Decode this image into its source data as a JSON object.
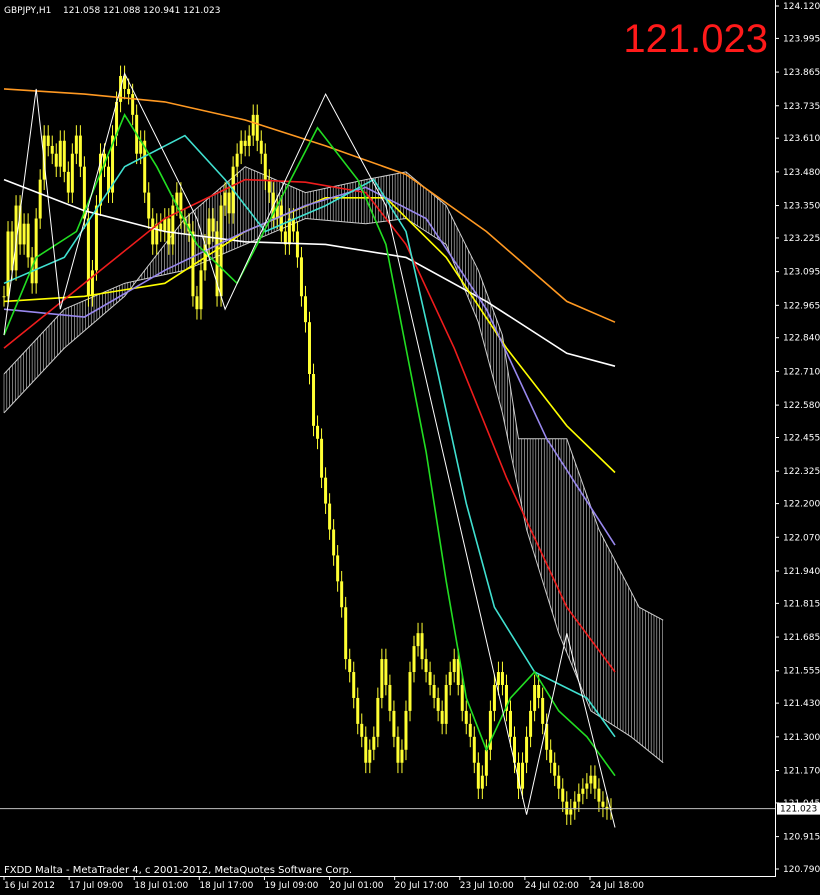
{
  "header": {
    "symbol": "GBPJPY,H1",
    "ohlc": "121.058 121.088 120.941 121.023"
  },
  "big_price": "121.023",
  "copyright": "FXDD Malta - MetaTrader 4, c 2001-2012, MetaQuotes Software Corp.",
  "colors": {
    "background": "#000000",
    "candles": "#ffff33",
    "sma_green": "#22dd22",
    "sma_cyan": "#40e0d0",
    "sma_red": "#ee1c1c",
    "sma_purple": "#9988ee",
    "sma_yellow": "#ffff00",
    "sma_white": "#ffffff",
    "sma_orange": "#ff9922",
    "cloud": "#cccccc",
    "zigzag": "#ffffff",
    "current_price_line": "#c0c0c0",
    "big_price": "#ff1a1a"
  },
  "chart_data": {
    "type": "line",
    "title": "GBPJPY,H1",
    "ylim": [
      120.79,
      124.12
    ],
    "y_ticks": [
      "124.120",
      "123.995",
      "123.865",
      "123.735",
      "123.610",
      "123.480",
      "123.350",
      "123.225",
      "123.095",
      "122.965",
      "122.840",
      "122.710",
      "122.580",
      "122.455",
      "122.325",
      "122.200",
      "122.070",
      "121.940",
      "121.815",
      "121.685",
      "121.555",
      "121.430",
      "121.300",
      "121.170",
      "121.045",
      "120.915",
      "120.790"
    ],
    "x_ticks": [
      "16 Jul 2012",
      "17 Jul 09:00",
      "18 Jul 01:00",
      "18 Jul 17:00",
      "19 Jul 09:00",
      "20 Jul 01:00",
      "20 Jul 17:00",
      "23 Jul 10:00",
      "24 Jul 02:00",
      "24 Jul 18:00"
    ],
    "current_price": 121.023,
    "bars": 152,
    "candles_close": [
      123.0,
      123.25,
      123.1,
      123.35,
      123.2,
      123.28,
      123.15,
      123.05,
      123.3,
      123.45,
      123.62,
      123.58,
      123.55,
      123.5,
      123.6,
      123.48,
      123.4,
      123.55,
      123.62,
      123.5,
      123.3,
      123.0,
      123.1,
      123.35,
      123.55,
      123.5,
      123.4,
      123.62,
      123.75,
      123.85,
      123.8,
      123.78,
      123.7,
      123.55,
      123.6,
      123.4,
      123.3,
      123.2,
      123.28,
      123.25,
      123.3,
      123.2,
      123.35,
      123.4,
      123.3,
      123.28,
      123.25,
      123.0,
      122.95,
      123.1,
      123.2,
      123.3,
      123.25,
      123.0,
      123.35,
      123.4,
      123.32,
      123.5,
      123.55,
      123.6,
      123.58,
      123.62,
      123.7,
      123.6,
      123.55,
      123.45,
      123.4,
      123.3,
      123.35,
      123.25,
      123.2,
      123.3,
      123.25,
      123.15,
      123.0,
      122.9,
      122.7,
      122.5,
      122.45,
      122.3,
      122.2,
      122.1,
      122.0,
      121.9,
      121.8,
      121.6,
      121.55,
      121.45,
      121.35,
      121.3,
      121.2,
      121.25,
      121.3,
      121.45,
      121.6,
      121.5,
      121.4,
      121.3,
      121.2,
      121.25,
      121.4,
      121.55,
      121.65,
      121.7,
      121.6,
      121.55,
      121.5,
      121.45,
      121.4,
      121.35,
      121.5,
      121.55,
      121.6,
      121.5,
      121.4,
      121.35,
      121.3,
      121.2,
      121.1,
      121.15,
      121.25,
      121.4,
      121.5,
      121.55,
      121.5,
      121.4,
      121.3,
      121.2,
      121.1,
      121.2,
      121.3,
      121.4,
      121.5,
      121.45,
      121.35,
      121.25,
      121.2,
      121.15,
      121.1,
      121.05,
      121.0,
      121.02,
      121.05,
      121.08,
      121.1,
      121.12,
      121.15,
      121.1,
      121.05,
      121.03,
      121.02,
      121.023
    ],
    "series": [
      {
        "name": "",
        "color_key": "sma_orange",
        "points": [
          [
            0,
            123.8
          ],
          [
            20,
            123.78
          ],
          [
            40,
            123.75
          ],
          [
            60,
            123.68
          ],
          [
            80,
            123.58
          ],
          [
            100,
            123.47
          ],
          [
            120,
            123.25
          ],
          [
            140,
            122.98
          ],
          [
            152,
            122.9
          ]
        ]
      },
      {
        "name": "",
        "color_key": "sma_white",
        "points": [
          [
            0,
            123.45
          ],
          [
            20,
            123.33
          ],
          [
            40,
            123.25
          ],
          [
            60,
            123.21
          ],
          [
            80,
            123.2
          ],
          [
            100,
            123.15
          ],
          [
            120,
            122.98
          ],
          [
            140,
            122.78
          ],
          [
            152,
            122.73
          ]
        ]
      },
      {
        "name": "",
        "color_key": "sma_yellow",
        "points": [
          [
            0,
            122.98
          ],
          [
            20,
            123.0
          ],
          [
            40,
            123.05
          ],
          [
            60,
            123.25
          ],
          [
            80,
            123.38
          ],
          [
            95,
            123.38
          ],
          [
            110,
            123.15
          ],
          [
            125,
            122.8
          ],
          [
            140,
            122.5
          ],
          [
            152,
            122.32
          ]
        ]
      },
      {
        "name": "",
        "color_key": "sma_purple",
        "points": [
          [
            0,
            122.95
          ],
          [
            20,
            122.92
          ],
          [
            40,
            123.1
          ],
          [
            60,
            123.25
          ],
          [
            75,
            123.35
          ],
          [
            90,
            123.42
          ],
          [
            105,
            123.3
          ],
          [
            120,
            122.95
          ],
          [
            135,
            122.45
          ],
          [
            152,
            122.04
          ]
        ]
      },
      {
        "name": "",
        "color_key": "sma_red",
        "points": [
          [
            0,
            122.8
          ],
          [
            20,
            123.05
          ],
          [
            40,
            123.3
          ],
          [
            60,
            123.45
          ],
          [
            75,
            123.44
          ],
          [
            90,
            123.4
          ],
          [
            100,
            123.2
          ],
          [
            112,
            122.8
          ],
          [
            125,
            122.3
          ],
          [
            140,
            121.8
          ],
          [
            152,
            121.55
          ]
        ]
      },
      {
        "name": "",
        "color_key": "sma_cyan",
        "points": [
          [
            0,
            123.05
          ],
          [
            15,
            123.15
          ],
          [
            30,
            123.5
          ],
          [
            45,
            123.62
          ],
          [
            55,
            123.45
          ],
          [
            65,
            123.25
          ],
          [
            80,
            123.35
          ],
          [
            92,
            123.45
          ],
          [
            100,
            123.25
          ],
          [
            108,
            122.7
          ],
          [
            115,
            122.2
          ],
          [
            122,
            121.8
          ],
          [
            132,
            121.55
          ],
          [
            145,
            121.45
          ],
          [
            152,
            121.3
          ]
        ]
      },
      {
        "name": "",
        "color_key": "sma_green",
        "points": [
          [
            0,
            122.85
          ],
          [
            8,
            123.15
          ],
          [
            18,
            123.25
          ],
          [
            30,
            123.7
          ],
          [
            38,
            123.5
          ],
          [
            48,
            123.2
          ],
          [
            58,
            123.05
          ],
          [
            68,
            123.35
          ],
          [
            78,
            123.65
          ],
          [
            88,
            123.45
          ],
          [
            95,
            123.2
          ],
          [
            100,
            122.8
          ],
          [
            105,
            122.4
          ],
          [
            110,
            121.9
          ],
          [
            115,
            121.45
          ],
          [
            120,
            121.25
          ],
          [
            126,
            121.45
          ],
          [
            132,
            121.55
          ],
          [
            138,
            121.4
          ],
          [
            145,
            121.3
          ],
          [
            152,
            121.15
          ]
        ]
      }
    ],
    "zigzag": [
      [
        0,
        122.85
      ],
      [
        8,
        123.8
      ],
      [
        14,
        122.95
      ],
      [
        30,
        123.86
      ],
      [
        48,
        123.3
      ],
      [
        55,
        122.95
      ],
      [
        80,
        123.78
      ],
      [
        95,
        123.35
      ],
      [
        130,
        121.0
      ],
      [
        140,
        121.7
      ],
      [
        152,
        120.95
      ]
    ],
    "ichimoku_cloud": {
      "spanA": [
        [
          0,
          122.55
        ],
        [
          15,
          122.8
        ],
        [
          30,
          123.0
        ],
        [
          45,
          123.3
        ],
        [
          60,
          123.5
        ],
        [
          75,
          123.4
        ],
        [
          90,
          123.45
        ],
        [
          100,
          123.48
        ],
        [
          110,
          123.35
        ],
        [
          118,
          123.1
        ],
        [
          124,
          122.85
        ],
        [
          128,
          122.45
        ],
        [
          140,
          122.45
        ],
        [
          148,
          122.1
        ],
        [
          158,
          121.8
        ],
        [
          164,
          121.75
        ]
      ],
      "spanB": [
        [
          0,
          122.7
        ],
        [
          15,
          122.95
        ],
        [
          30,
          123.05
        ],
        [
          45,
          123.1
        ],
        [
          60,
          123.2
        ],
        [
          75,
          123.3
        ],
        [
          90,
          123.28
        ],
        [
          100,
          123.3
        ],
        [
          110,
          123.2
        ],
        [
          118,
          122.9
        ],
        [
          124,
          122.55
        ],
        [
          130,
          122.1
        ],
        [
          138,
          121.7
        ],
        [
          146,
          121.4
        ],
        [
          156,
          121.3
        ],
        [
          164,
          121.2
        ]
      ]
    }
  }
}
